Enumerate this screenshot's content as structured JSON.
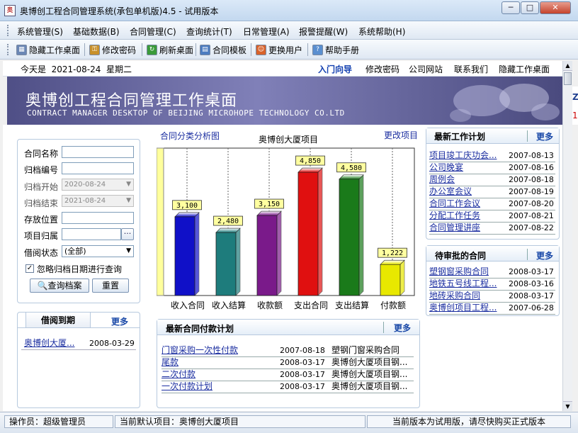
{
  "window": {
    "title": "奥博创工程合同管理系统(承包单机版)4.5 - 试用版本",
    "app_icon": "app-icon",
    "buttons": [
      "minimize-icon",
      "maximize-icon",
      "close-icon"
    ]
  },
  "menu": [
    "系统管理(S)",
    "基础数据(B)",
    "合同管理(C)",
    "查询统计(T)",
    "日常管理(A)",
    "报警提醒(W)",
    "系统帮助(H)"
  ],
  "toolbar": [
    {
      "label": "隐藏工作桌面",
      "icon": "desktop-icon",
      "color": "#6b87b5"
    },
    {
      "label": "修改密码",
      "icon": "key-icon",
      "color": "#c8902a"
    },
    {
      "label": "刷新桌面",
      "icon": "refresh-icon",
      "color": "#3a9a3a"
    },
    {
      "label": "合同模板",
      "icon": "template-icon",
      "color": "#4c7cc0"
    },
    {
      "label": "更换用户",
      "icon": "user-icon",
      "color": "#d8622a"
    },
    {
      "label": "帮助手册",
      "icon": "help-icon",
      "color": "#5a8fd0"
    }
  ],
  "info": {
    "today": "今天是  2021-08-24  星期二",
    "links": [
      "入门向导",
      "修改密码",
      "公司网站",
      "联系我们",
      "隐藏工作桌面"
    ]
  },
  "banner": {
    "title": "奥博创工程合同管理工作桌面",
    "subtitle": "CONTRACT MANAGER DESKTOP OF BEIJING MICROHOPE TECHNOLOGY CO.LTD"
  },
  "search": {
    "fields": {
      "name": {
        "label": "合同名称",
        "value": ""
      },
      "archive_no": {
        "label": "归档编号",
        "value": ""
      },
      "start": {
        "label": "归档开始",
        "value": "2020-08-24"
      },
      "end": {
        "label": "归档结束",
        "value": "2021-08-24"
      },
      "location": {
        "label": "存放位置",
        "value": ""
      },
      "project": {
        "label": "项目归属",
        "value": "",
        "button": "···"
      },
      "borrow": {
        "label": "借阅状态",
        "value": "(全部)"
      }
    },
    "ignore_date_label": "忽略归档日期进行查询",
    "ignore_date_checked": true,
    "query_button": "查询档案",
    "reset_button": "重置"
  },
  "borrow_due": {
    "title": "借阅到期",
    "more": "更多",
    "rows": [
      {
        "name": "奥博创大厦...",
        "date": "2008-03-29"
      }
    ]
  },
  "chart_header": {
    "left_link": "合同分类分析图",
    "project": "奥博创大厦项目",
    "change_link": "更改项目"
  },
  "chart_data": {
    "type": "bar",
    "title": "奥博创大厦项目",
    "categories": [
      "收入合同",
      "收入结算",
      "收款额",
      "支出合同",
      "支出结算",
      "付款额"
    ],
    "values": [
      3100,
      2480,
      3150,
      4850,
      4580,
      1222
    ],
    "value_labels": [
      "3,100",
      "2,480",
      "3,150",
      "4,850",
      "4,580",
      "1,222"
    ],
    "colors": [
      "#1010c8",
      "#1e7c7c",
      "#7a1a8a",
      "#e01010",
      "#1a7a1a",
      "#e8e800"
    ],
    "ylim": [
      0,
      5800
    ]
  },
  "payment_plan": {
    "title": "最新合同付款计划",
    "more": "更多",
    "rows": [
      {
        "name": "门窗采购一次性付款",
        "date": "2007-08-18",
        "contract": "塑钢门窗采购合同"
      },
      {
        "name": "尾款",
        "date": "2008-03-17",
        "contract": "奥博创大厦项目钢..."
      },
      {
        "name": "二次付款",
        "date": "2008-03-17",
        "contract": "奥博创大厦项目钢..."
      },
      {
        "name": "一次付款计划",
        "date": "2008-03-17",
        "contract": "奥博创大厦项目钢..."
      }
    ]
  },
  "work_plan": {
    "title": "最新工作计划",
    "more": "更多",
    "rows": [
      {
        "name": "项目竣工庆功会...",
        "date": "2007-08-13"
      },
      {
        "name": "公司晚宴",
        "date": "2007-08-16"
      },
      {
        "name": "周例会",
        "date": "2007-08-18"
      },
      {
        "name": "办公室会议",
        "date": "2007-08-19"
      },
      {
        "name": "合同工作会议",
        "date": "2007-08-20"
      },
      {
        "name": "分配工作任务",
        "date": "2007-08-21"
      },
      {
        "name": "合同管理讲座",
        "date": "2007-08-22"
      }
    ]
  },
  "pending": {
    "title": "待审批的合同",
    "more": "更多",
    "rows": [
      {
        "name": "塑钢窗采购合同",
        "date": "2008-03-17"
      },
      {
        "name": "地铁五号线工程...",
        "date": "2008-03-16"
      },
      {
        "name": "地砖采购合同",
        "date": "2008-03-17"
      },
      {
        "name": "奥博创项目工程...",
        "date": "2007-06-28"
      }
    ]
  },
  "side_peek": [
    "Z",
    "1"
  ],
  "status": {
    "operator": "操作员：超级管理员",
    "project": "当前默认项目：奥博创大厦项目",
    "notice": "当前版本为试用版，请尽快购买正式版本"
  }
}
